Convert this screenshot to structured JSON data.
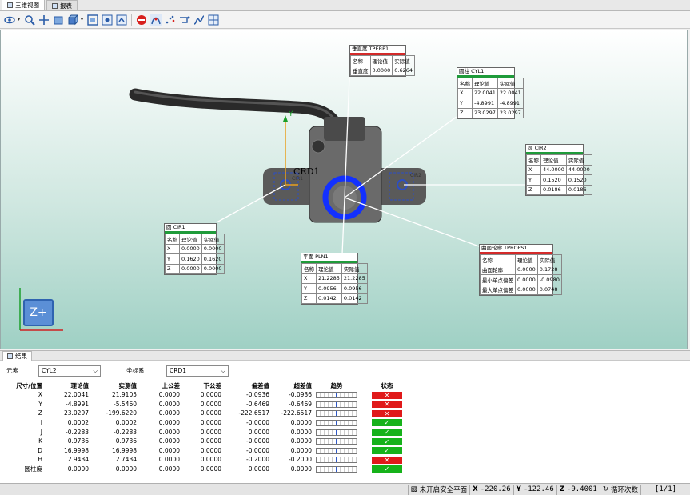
{
  "tabs": [
    {
      "label": "三维视图",
      "icon": "3d-view-icon"
    },
    {
      "label": "报表",
      "icon": "report-icon"
    }
  ],
  "toolbar": {
    "icons": [
      "eye-icon",
      "zoom-icon",
      "pan-icon",
      "rotate-icon",
      "view-cube-icon",
      "fit-icon",
      "view-save-icon",
      "view-load-icon",
      "stop-icon",
      "probe-icon",
      "scatter-icon",
      "path-icon",
      "curve-icon",
      "grid-icon"
    ]
  },
  "viewport": {
    "labels": {
      "crd": "CRD1",
      "cir1": "CIR1",
      "cir2": "CIR2",
      "axis_y": "Y"
    },
    "view_badge": "Z+",
    "annotations": [
      {
        "id": "tperp",
        "title": "垂直度 TPERP1",
        "bar": "#d32a2a",
        "cols": [
          "名称",
          "理论值",
          "实际值"
        ],
        "rows": [
          [
            "垂直度",
            "0.0000",
            "0.6264"
          ]
        ]
      },
      {
        "id": "cyl1",
        "title": "圆柱 CYL1",
        "bar": "#1f9b3a",
        "cols": [
          "名称",
          "理论值",
          "实际值"
        ],
        "rows": [
          [
            "X",
            "22.0041",
            "22.0041"
          ],
          [
            "Y",
            "-4.8991",
            "-4.8991"
          ],
          [
            "Z",
            "23.0297",
            "23.0297"
          ]
        ]
      },
      {
        "id": "cir2",
        "title": "圆 CIR2",
        "bar": "#1f9b3a",
        "cols": [
          "名称",
          "理论值",
          "实际值"
        ],
        "rows": [
          [
            "X",
            "44.0000",
            "44.0000"
          ],
          [
            "Y",
            "0.1520",
            "0.1520"
          ],
          [
            "Z",
            "0.0186",
            "0.0186"
          ]
        ]
      },
      {
        "id": "tprofs",
        "title": "曲面轮廓 TPROFS1",
        "bar": "#d32a2a",
        "cols": [
          "名称",
          "理论值",
          "实际值"
        ],
        "rows": [
          [
            "曲面轮廓",
            "0.0000",
            "0.1728"
          ],
          [
            "最小单点偏差",
            "0.0000",
            "-0.0980"
          ],
          [
            "最大单点偏差",
            "0.0000",
            "0.0748"
          ]
        ]
      },
      {
        "id": "pln1",
        "title": "平面 PLN1",
        "bar": "#1f9b3a",
        "cols": [
          "名称",
          "理论值",
          "实际值"
        ],
        "rows": [
          [
            "X",
            "21.2285",
            "21.2285"
          ],
          [
            "Y",
            "0.0956",
            "0.0956"
          ],
          [
            "Z",
            "0.0142",
            "0.0142"
          ]
        ]
      },
      {
        "id": "cir1",
        "title": "圆 CIR1",
        "bar": "#1f9b3a",
        "cols": [
          "名称",
          "理论值",
          "实际值"
        ],
        "rows": [
          [
            "X",
            "0.0000",
            "0.0000"
          ],
          [
            "Y",
            "0.1620",
            "0.1620"
          ],
          [
            "Z",
            "0.0000",
            "0.0000"
          ]
        ]
      }
    ]
  },
  "results": {
    "tab_label": "结果",
    "element_label": "元素",
    "element_value": "CYL2",
    "coord_label": "坐标系",
    "coord_value": "CRD1",
    "columns": [
      "尺寸/位置",
      "理论值",
      "实测值",
      "上公差",
      "下公差",
      "偏差值",
      "超差值",
      "趋势",
      "状态"
    ],
    "rows": [
      {
        "name": "X",
        "nominal": "22.0041",
        "measured": "21.9105",
        "upper": "0.0000",
        "lower": "0.0000",
        "dev": "-0.0936",
        "out": "-0.0936",
        "pass": false
      },
      {
        "name": "Y",
        "nominal": "-4.8991",
        "measured": "-5.5460",
        "upper": "0.0000",
        "lower": "0.0000",
        "dev": "-0.6469",
        "out": "-0.6469",
        "pass": false
      },
      {
        "name": "Z",
        "nominal": "23.0297",
        "measured": "-199.6220",
        "upper": "0.0000",
        "lower": "0.0000",
        "dev": "-222.6517",
        "out": "-222.6517",
        "pass": false
      },
      {
        "name": "I",
        "nominal": "0.0002",
        "measured": "0.0002",
        "upper": "0.0000",
        "lower": "0.0000",
        "dev": "-0.0000",
        "out": "0.0000",
        "pass": true
      },
      {
        "name": "J",
        "nominal": "-0.2283",
        "measured": "-0.2283",
        "upper": "0.0000",
        "lower": "0.0000",
        "dev": "0.0000",
        "out": "0.0000",
        "pass": true
      },
      {
        "name": "K",
        "nominal": "0.9736",
        "measured": "0.9736",
        "upper": "0.0000",
        "lower": "0.0000",
        "dev": "-0.0000",
        "out": "0.0000",
        "pass": true
      },
      {
        "name": "D",
        "nominal": "16.9998",
        "measured": "16.9998",
        "upper": "0.0000",
        "lower": "0.0000",
        "dev": "-0.0000",
        "out": "0.0000",
        "pass": true
      },
      {
        "name": "H",
        "nominal": "2.9434",
        "measured": "2.7434",
        "upper": "0.0000",
        "lower": "0.0000",
        "dev": "-0.2000",
        "out": "-0.2000",
        "pass": false
      },
      {
        "name": "圆柱度",
        "nominal": "0.0000",
        "measured": "0.0000",
        "upper": "0.0000",
        "lower": "0.0000",
        "dev": "0.0000",
        "out": "0.0000",
        "pass": true
      }
    ],
    "colors": {
      "pass": "#16b21a",
      "fail": "#e0191a"
    }
  },
  "statusbar": {
    "safe_plane": "未开启安全平面",
    "x_label": "X",
    "x_value": "-220.26",
    "y_label": "Y",
    "y_value": "-122.46",
    "z_label": "Z",
    "z_value": "-9.4001",
    "loop_label": "循环次数",
    "loop_value": "[1/1]"
  }
}
